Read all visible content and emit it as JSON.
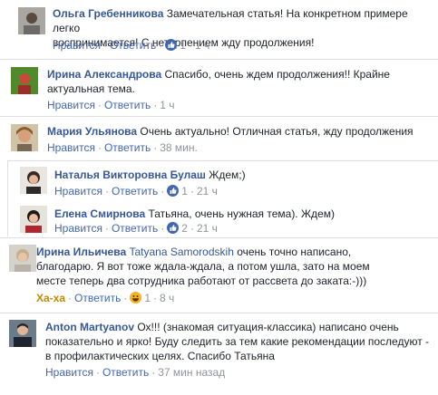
{
  "ui": {
    "like": "Нравится",
    "reply": "Ответить",
    "haha": "Ха-ха",
    "dot": "·"
  },
  "comments": [
    {
      "name": "Ольга Гребенникова",
      "line1": "Замечательная статья! На конкретном примере легко",
      "line2": "воспринимается! С нетерпением жду продолжения!",
      "reaction_count": "1",
      "time": "1 ч"
    },
    {
      "name": "Ирина Александрова",
      "line1": "Спасибо, очень ждем продолжения!! Крайне",
      "line2": "актуальная тема.",
      "time": "1 ч"
    },
    {
      "name": "Мария Ульянова",
      "line1": "Очень актуально! Отличная статья, жду продолжения",
      "time": "38 мин."
    },
    {
      "name": "Наталья Викторовна Булаш",
      "line1": "Ждем;)",
      "reaction_count": "1",
      "time": "21 ч"
    },
    {
      "name": "Елена Смирнова",
      "line1": "Татьяна, очень нужная тема). Ждем)",
      "reaction_count": "2",
      "time": "21 ч"
    },
    {
      "name": "Ирина Ильичева",
      "mention": "Tatyana Samorodskih",
      "line1": "очень точно написано,",
      "line2": "благодарю. Я вот тоже ждала-ждала, а потом ушла, зато на моем",
      "line3": "месте теперь два сотрудника работают от рассвета до заката:-)))",
      "reaction_count": "1",
      "time": "8 ч"
    },
    {
      "name": "Anton Martyanov",
      "line1": "Ох!!! (знакомая ситуация-классика) написано очень",
      "line2": "показательно и ярко! Буду следить за тем какие рекомендации последуют -",
      "line3": "в профилактических целях. Спасибо Татьяна",
      "time": "37 мин назад"
    }
  ]
}
